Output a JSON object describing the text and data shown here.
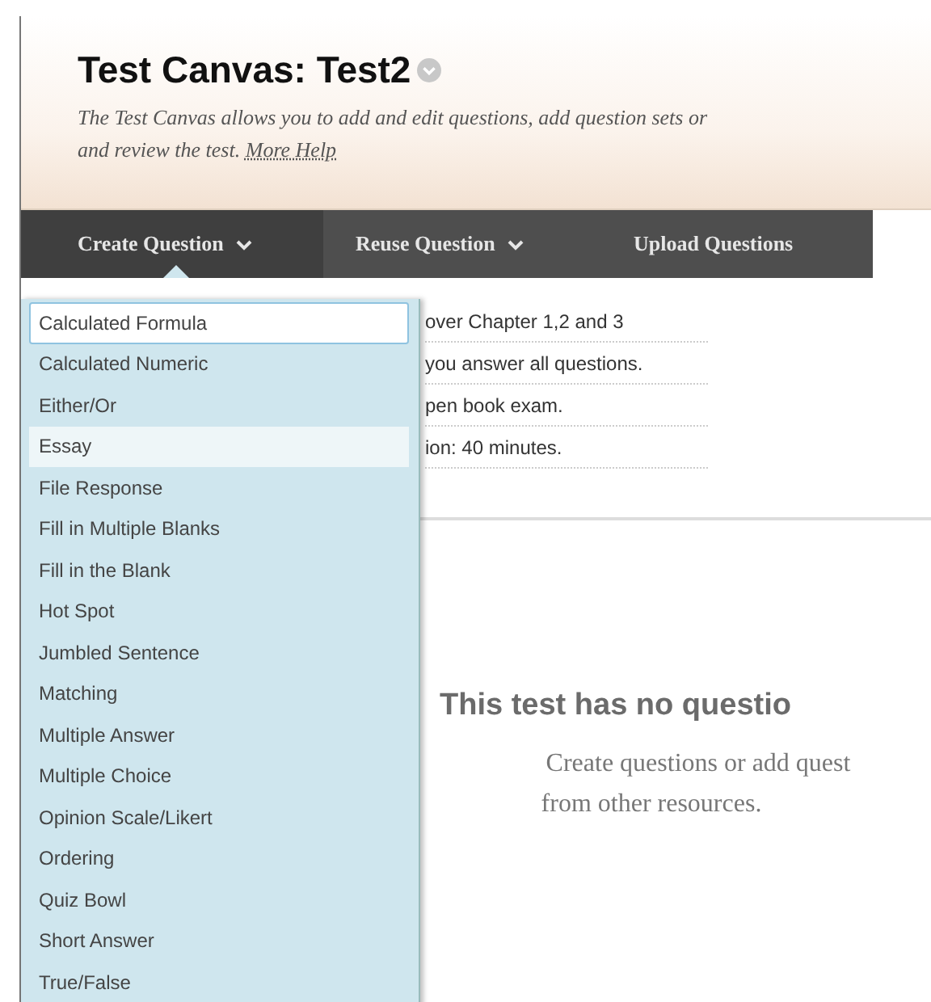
{
  "header": {
    "title": "Test Canvas: Test2",
    "description": "The Test Canvas allows you to add and edit questions, add question sets or",
    "description_line2": "and review the test.",
    "help_link": "More Help"
  },
  "toolbar": [
    {
      "label": "Create Question",
      "has_menu": true,
      "selected": true
    },
    {
      "label": "Reuse Question",
      "has_menu": true,
      "selected": false
    },
    {
      "label": "Upload Questions",
      "has_menu": false,
      "selected": false
    }
  ],
  "menu": [
    {
      "label": "Calculated Formula",
      "focused": true,
      "hovered": false
    },
    {
      "label": "Calculated Numeric",
      "focused": false,
      "hovered": false
    },
    {
      "label": "Either/Or",
      "focused": false,
      "hovered": false
    },
    {
      "label": "Essay",
      "focused": false,
      "hovered": true
    },
    {
      "label": "File Response",
      "focused": false,
      "hovered": false
    },
    {
      "label": "Fill in Multiple Blanks",
      "focused": false,
      "hovered": false
    },
    {
      "label": "Fill in the Blank",
      "focused": false,
      "hovered": false
    },
    {
      "label": "Hot Spot",
      "focused": false,
      "hovered": false
    },
    {
      "label": "Jumbled Sentence",
      "focused": false,
      "hovered": false
    },
    {
      "label": "Matching",
      "focused": false,
      "hovered": false
    },
    {
      "label": "Multiple Answer",
      "focused": false,
      "hovered": false
    },
    {
      "label": "Multiple Choice",
      "focused": false,
      "hovered": false
    },
    {
      "label": "Opinion Scale/Likert",
      "focused": false,
      "hovered": false
    },
    {
      "label": "Ordering",
      "focused": false,
      "hovered": false
    },
    {
      "label": "Quiz Bowl",
      "focused": false,
      "hovered": false
    },
    {
      "label": "Short Answer",
      "focused": false,
      "hovered": false
    },
    {
      "label": "True/False",
      "focused": false,
      "hovered": false
    }
  ],
  "instructions": [
    "over Chapter 1,2 and 3",
    "you answer all questions.",
    "pen book exam.",
    "ion: 40 minutes."
  ],
  "empty_state": {
    "heading": "This test has no questio",
    "text_line1": "Create questions or add quest",
    "text_line2": "from other resources."
  }
}
